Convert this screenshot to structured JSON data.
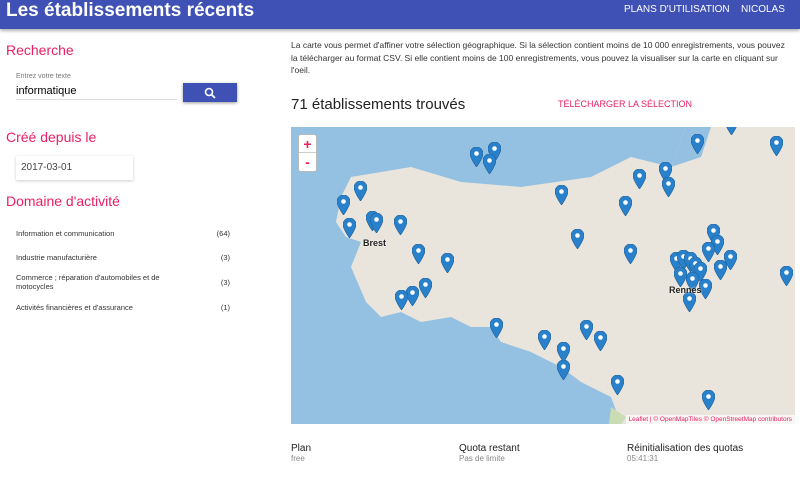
{
  "header": {
    "title": "Les établissements récents",
    "nav": [
      "PLANS D'UTILISATION",
      "NICOLAS"
    ]
  },
  "sidebar": {
    "search": {
      "heading": "Recherche",
      "label": "Entrez votre texte",
      "value": "informatique",
      "icon": "search-icon"
    },
    "date": {
      "heading": "Créé depuis le",
      "value": "2017-03-01"
    },
    "domains": {
      "heading": "Domaine d'activité",
      "items": [
        {
          "label": "Information et communication",
          "count": "(64)"
        },
        {
          "label": "Industrie manufacturière",
          "count": "(3)"
        },
        {
          "label": "Commerce ; réparation d'automobiles et de motocycles",
          "count": "(3)"
        },
        {
          "label": "Activités financières et d'assurance",
          "count": "(1)"
        }
      ]
    }
  },
  "main": {
    "description": "La carte vous permet d'affiner votre sélection géographique. Si la sélection contient moins de 10 000 enregistrements, vous pouvez la télécharger au format CSV. Si elle contient moins de 100 enregistrements, vous pouvez la visualiser sur la carte en cliquant sur l'oeil.",
    "count": "71 établissements trouvés",
    "download": "TÉLÉCHARGER LA SÉLECTION",
    "map": {
      "zoom_in": "+",
      "zoom_out": "-",
      "cities": [
        "Brest",
        "Rennes"
      ],
      "attribution": "Leaflet | © OpenMapTiles © OpenStreetMap contributors",
      "sea_color": "#94c1e1",
      "land_color": "#e9e5dc",
      "marker_color": "#2a81cb"
    }
  },
  "footer": [
    {
      "label": "Plan",
      "value": "free"
    },
    {
      "label": "Quota restant",
      "value": "Pas de limite"
    },
    {
      "label": "Réinitialisation des quotas",
      "value": "05:41:31"
    }
  ]
}
